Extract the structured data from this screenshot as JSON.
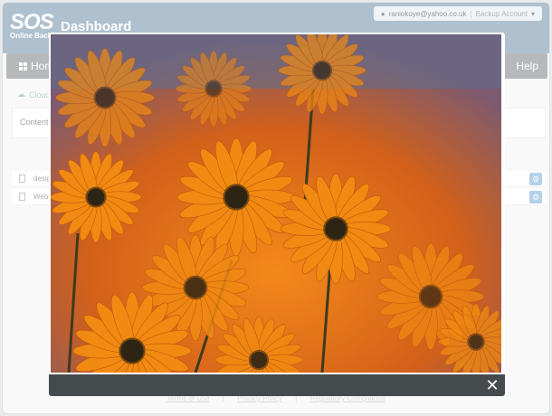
{
  "header": {
    "logo": "SOS",
    "logo_sub": "Online Backup",
    "title": "Dashboard",
    "account_email": "raniokoye@yahoo.co.uk",
    "account_menu": "Backup Account"
  },
  "nav": {
    "home": "Home",
    "help": "Help"
  },
  "background": {
    "crumb": "Cloud",
    "panel_title": "Content T",
    "rows": [
      "desig",
      "Webs"
    ]
  },
  "footer": {
    "links": [
      "Terms of Use",
      "Privacy Policy",
      "Regulatory Compliance"
    ]
  },
  "lightbox": {
    "close_icon": "close-icon",
    "photo_subject": "orange-daisy-flowers"
  },
  "colors": {
    "header": "#6e8fa6",
    "nav": "#7c7f81",
    "lightbox_bar": "#454a4d",
    "flower_orange": "#f08a12",
    "flower_center": "#2e2414"
  }
}
